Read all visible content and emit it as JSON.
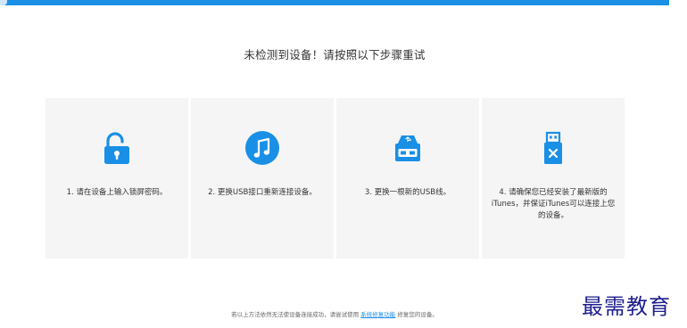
{
  "colors": {
    "accent": "#1a8fe6",
    "card_bg": "#f5f5f5",
    "watermark": "#1f1f8f"
  },
  "headline": "未检测到设备！请按照以下步骤重试",
  "steps": [
    {
      "icon": "unlock-icon",
      "text": "1. 请在设备上输入锁屏密码。"
    },
    {
      "icon": "itunes-music-icon",
      "text": "2. 更换USB接口重新连接设备。"
    },
    {
      "icon": "usb-port-icon",
      "text": "3. 更换一根新的USB线。"
    },
    {
      "icon": "usb-drive-error-icon",
      "text": "4. 请确保您已经安装了最新版的iTunes，并保证iTunes可以连接上您的设备。"
    }
  ],
  "footer": {
    "prefix": "若以上方法依然无法使设备连接成功，请尝试使用",
    "link": "系统修复功能",
    "suffix": "修复您的设备。"
  },
  "watermark": "最需教育"
}
